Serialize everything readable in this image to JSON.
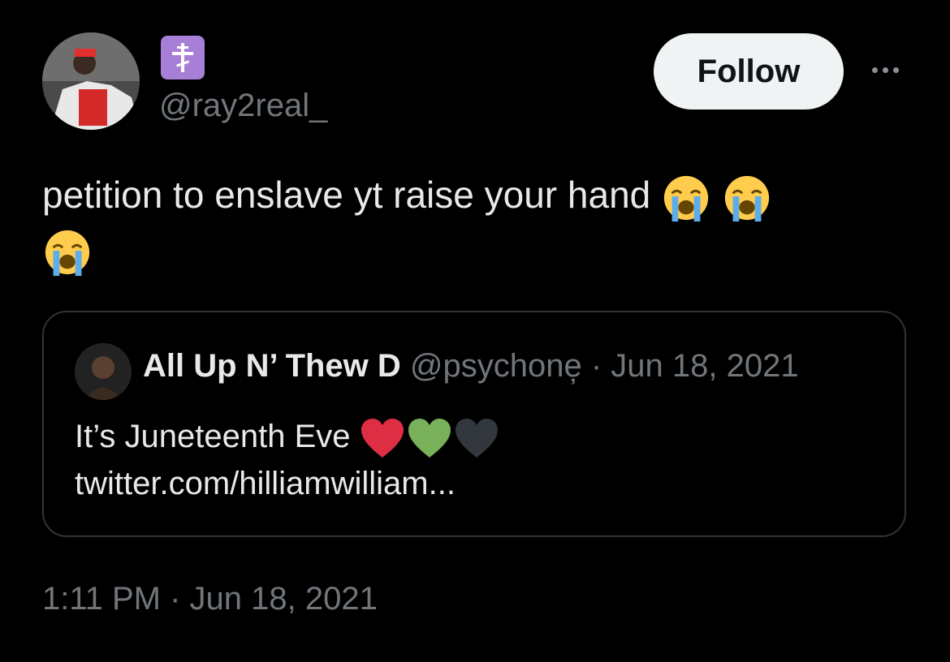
{
  "author": {
    "handle": "@ray2real_",
    "badge_icon": "orthodox-cross-icon",
    "badge_color": "#a87fd6"
  },
  "actions": {
    "follow_label": "Follow",
    "more_icon": "more-horizontal-icon"
  },
  "tweet": {
    "text": "petition to enslave yt raise your hand",
    "emojis": [
      "loudly-crying-face",
      "loudly-crying-face",
      "loudly-crying-face"
    ]
  },
  "quote": {
    "name": "All Up N’ Thew D",
    "handle_date": "@psychone̦ · Jun 18, 2021",
    "text": "It’s Juneteenth Eve",
    "hearts": [
      {
        "icon": "red-heart-icon",
        "color": "#dd2e44"
      },
      {
        "icon": "green-heart-icon",
        "color": "#78b159"
      },
      {
        "icon": "black-heart-icon",
        "color": "#31373d"
      }
    ],
    "link": "twitter.com/hilliamwilliam..."
  },
  "timestamp": "1:11 PM · Jun 18, 2021",
  "colors": {
    "background": "#000000",
    "text_primary": "#e7e9ea",
    "text_secondary": "#71767b",
    "border": "#2f3336",
    "follow_bg": "#eff3f4"
  }
}
